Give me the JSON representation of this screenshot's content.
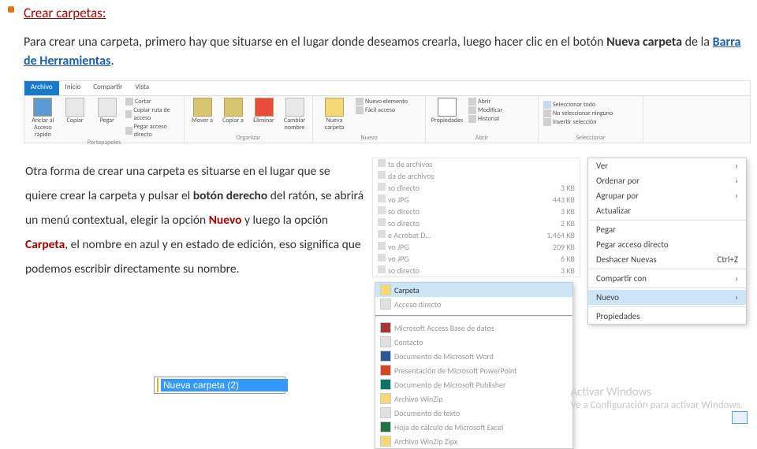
{
  "bullet": "•",
  "title": "Crear carpetas:",
  "para1_a": "Para crear una carpeta, primero hay que situarse en el lugar donde deseamos crearla, luego hacer clic en el botón ",
  "para1_b": "Nueva carpeta",
  "para1_c": " de la ",
  "para1_d": "Barra de Herramientas",
  "para1_e": ".",
  "ribbon": {
    "tabs": [
      "Archivo",
      "Inicio",
      "Compartir",
      "Vista"
    ],
    "groups": {
      "portapapeles": {
        "label": "Portapapeles",
        "anclar": "Anclar al Acceso rápido",
        "copiar": "Copiar",
        "pegar": "Pegar",
        "cortar": "Cortar",
        "copiar_ruta": "Copiar ruta de acceso",
        "pegar_directo": "Pegar acceso directo"
      },
      "organizar": {
        "label": "Organizar",
        "mover": "Mover a",
        "copiar_a": "Copiar a",
        "eliminar": "Eliminar",
        "cambiar": "Cambiar nombre"
      },
      "nuevo": {
        "label": "Nuevo",
        "nueva_carpeta": "Nueva carpeta",
        "nuevo_elemento": "Nuevo elemento",
        "facil": "Fácil acceso"
      },
      "abrir": {
        "label": "Abrir",
        "propiedades": "Propiedades",
        "abrir": "Abrir",
        "modificar": "Modificar",
        "historial": "Historial"
      },
      "seleccionar": {
        "label": "Seleccionar",
        "todo": "Seleccionar todo",
        "ninguno": "No seleccionar ninguno",
        "invertir": "Invertir selección"
      }
    }
  },
  "para2_parts": {
    "a": "Otra forma de crear una carpeta es situarse en el lugar que se quiere crear la carpeta y pulsar el ",
    "b": "botón derecho",
    "c": " del ratón, se abrirá un menú contextual, elegir la opción ",
    "d": "Nuevo",
    "e": " y luego la opción ",
    "f": "Carpeta",
    "g": ", el nombre en azul y en estado de edición, eso significa que podemos escribir directamente su nombre."
  },
  "newfolder_name": "Nueva carpeta (2)",
  "filelist": [
    {
      "n": "ta de archivos",
      "s": ""
    },
    {
      "n": "da de archivos",
      "s": ""
    },
    {
      "n": "so directo",
      "s": "3 KB"
    },
    {
      "n": "vo JPG",
      "s": "443 KB"
    },
    {
      "n": "so directo",
      "s": "3 KB"
    },
    {
      "n": "so directo",
      "s": "2 KB"
    },
    {
      "n": "e Acrobat D…",
      "s": "1.464 KB"
    },
    {
      "n": "vo JPG",
      "s": "209 KB"
    },
    {
      "n": "vo JPG",
      "s": "6 KB"
    },
    {
      "n": "so directo",
      "s": "3 KB"
    }
  ],
  "submenu": [
    "Carpeta",
    "Acceso directo",
    "Microsoft Access Base de datos",
    "Contacto",
    "Documento de Microsoft Word",
    "Presentación de Microsoft PowerPoint",
    "Documento de Microsoft Publisher",
    "Archivo WinZip",
    "Documento de texto",
    "Hoja de cálculo de Microsoft Excel",
    "Archivo WinZip Zipx"
  ],
  "ctxmenu": {
    "ver": "Ver",
    "ordenar": "Ordenar por",
    "agrupar": "Agrupar por",
    "actualizar": "Actualizar",
    "pegar": "Pegar",
    "pegar_ad": "Pegar acceso directo",
    "deshacer": "Deshacer Nuevas",
    "deshacer_k": "Ctrl+Z",
    "compartir": "Compartir con",
    "nuevo": "Nuevo",
    "propiedades": "Propiedades",
    "arrow": "›"
  },
  "watermark": {
    "t": "Activar Windows",
    "s": "Ve a Configuración para activar Windows."
  }
}
